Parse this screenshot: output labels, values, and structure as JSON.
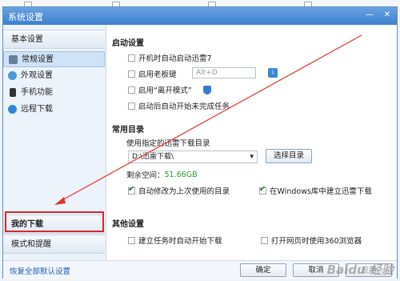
{
  "window": {
    "title": "系统设置"
  },
  "sidebar": {
    "sections": [
      {
        "label": "基本设置"
      },
      {
        "label": "我的下载"
      },
      {
        "label": "模式和提醒"
      }
    ],
    "items": [
      {
        "label": "常规设置",
        "icon": "gear-icon"
      },
      {
        "label": "外观设置",
        "icon": "appearance-icon"
      },
      {
        "label": "手机功能",
        "icon": "phone-icon"
      },
      {
        "label": "远程下载",
        "icon": "remote-icon"
      }
    ]
  },
  "startup": {
    "title": "启动设置",
    "autostart": "开机时自动启动迅雷7",
    "bosskey": "启用老板键",
    "bosskey_value": "Alt+D",
    "away_mode": "启用“离开模式”",
    "resume": "启动后自动开始未完成任务"
  },
  "dirs": {
    "title": "常用目录",
    "label": "使用指定的迅雷下载目录",
    "path": "D:\\迅雷下载\\",
    "choose": "选择目录",
    "space": "剩余空间：",
    "space_value": "51.66GB",
    "auto_update": "自动修改为上次使用的目录",
    "win_lib": "在Windows库中建立迅雷下载"
  },
  "other": {
    "title": "其他设置",
    "auto_start_task": "建立任务时自动开始下载",
    "use_360": "打开网页时使用360浏览器"
  },
  "footer": {
    "restore": "恢复全部默认设置",
    "ok": "确定",
    "cancel": "取消",
    "apply": "应用"
  },
  "watermark": "Baidu 经验",
  "colors": {
    "accent": "#3b7fcf",
    "highlight": "#d9262c",
    "arrow": "#e0352f",
    "space": "#2e9a2e"
  }
}
